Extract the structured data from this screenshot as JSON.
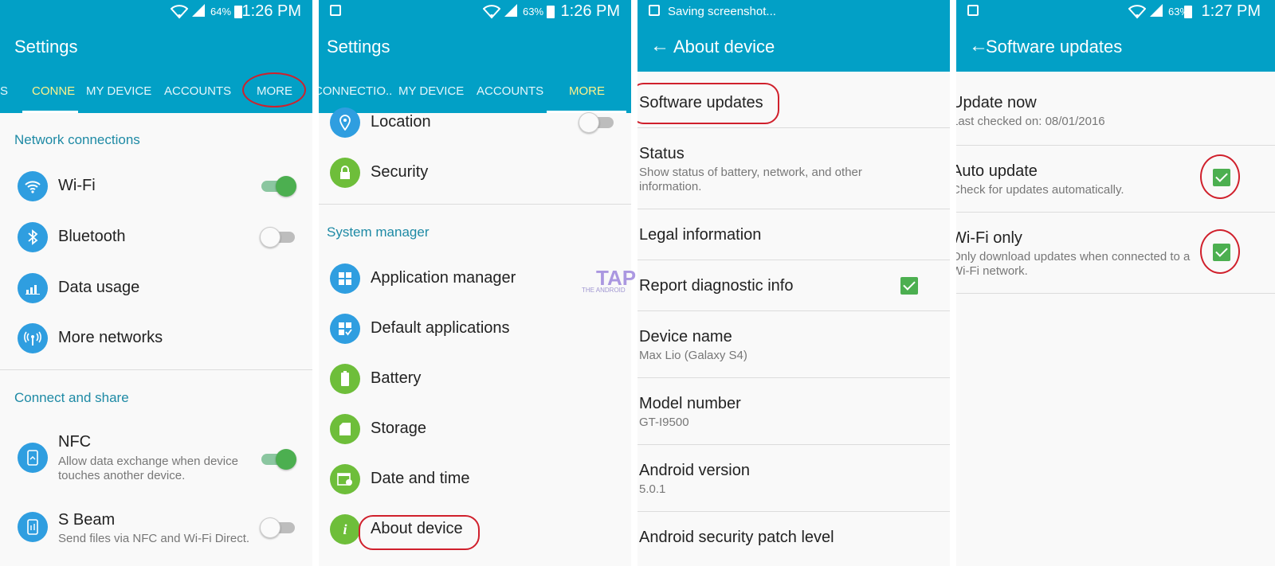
{
  "colors": {
    "primary": "#02a0c6",
    "accent_tab": "#fff28a",
    "section": "#1e8aa5",
    "annotation": "#d0202c",
    "check": "#4caf50"
  },
  "panel1": {
    "status": {
      "battery": "64%",
      "time": "1:26 PM"
    },
    "title": "Settings",
    "tabs": {
      "partial": "S",
      "connections": "CONNE",
      "my_device": "MY DEVICE",
      "accounts": "ACCOUNTS",
      "more": "MORE"
    },
    "network_header": "Network connections",
    "network_items": [
      {
        "label": "Wi-Fi",
        "icon": "wifi-icon",
        "toggle": "on"
      },
      {
        "label": "Bluetooth",
        "icon": "bluetooth-icon",
        "toggle": "off"
      },
      {
        "label": "Data usage",
        "icon": "data-usage-icon"
      },
      {
        "label": "More networks",
        "icon": "more-networks-icon"
      }
    ],
    "share_header": "Connect and share",
    "nfc": {
      "label": "NFC",
      "sub": "Allow data exchange when device touches another device.",
      "toggle": "on"
    },
    "sbeam": {
      "label": "S Beam",
      "sub": "Send files via NFC and Wi-Fi Direct.",
      "toggle": "off"
    }
  },
  "panel2": {
    "status": {
      "battery": "63%",
      "time": "1:26 PM"
    },
    "title": "Settings",
    "tabs": {
      "connections": "CONNECTIO..",
      "my_device": "MY DEVICE",
      "accounts": "ACCOUNTS",
      "more": "MORE"
    },
    "location": "Location",
    "security": "Security",
    "system_header": "System manager",
    "items": [
      {
        "label": "Application manager",
        "icon": "app-manager-icon"
      },
      {
        "label": "Default applications",
        "icon": "default-apps-icon"
      },
      {
        "label": "Battery",
        "icon": "battery-icon"
      },
      {
        "label": "Storage",
        "icon": "storage-icon"
      },
      {
        "label": "Date and time",
        "icon": "calendar-icon"
      },
      {
        "label": "About device",
        "icon": "info-icon"
      }
    ]
  },
  "panel3": {
    "status": {
      "saving": "Saving screenshot..."
    },
    "title": "About device",
    "items": [
      {
        "title": "Software updates",
        "sub": ""
      },
      {
        "title": "Status",
        "sub": "Show status of battery, network, and other information."
      },
      {
        "title": "Legal information",
        "sub": ""
      },
      {
        "title": "Report diagnostic info",
        "sub": ""
      },
      {
        "title": "Device name",
        "sub": "Max Lio (Galaxy S4)"
      },
      {
        "title": "Model number",
        "sub": "GT-I9500"
      },
      {
        "title": "Android version",
        "sub": "5.0.1"
      },
      {
        "title": "Android security patch level",
        "sub": ""
      }
    ],
    "watermark": "TAP",
    "watermark_sub": "THE ANDROID"
  },
  "panel4": {
    "status": {
      "battery": "63%",
      "time": "1:27 PM"
    },
    "title": "Software updates",
    "items": [
      {
        "title": "Update now",
        "sub": "Last checked on: 08/01/2016"
      },
      {
        "title": "Auto update",
        "sub": "Check for updates automatically.",
        "checked": true
      },
      {
        "title": "Wi-Fi only",
        "sub": "Only download updates when connected to a Wi-Fi network.",
        "checked": true
      }
    ]
  }
}
